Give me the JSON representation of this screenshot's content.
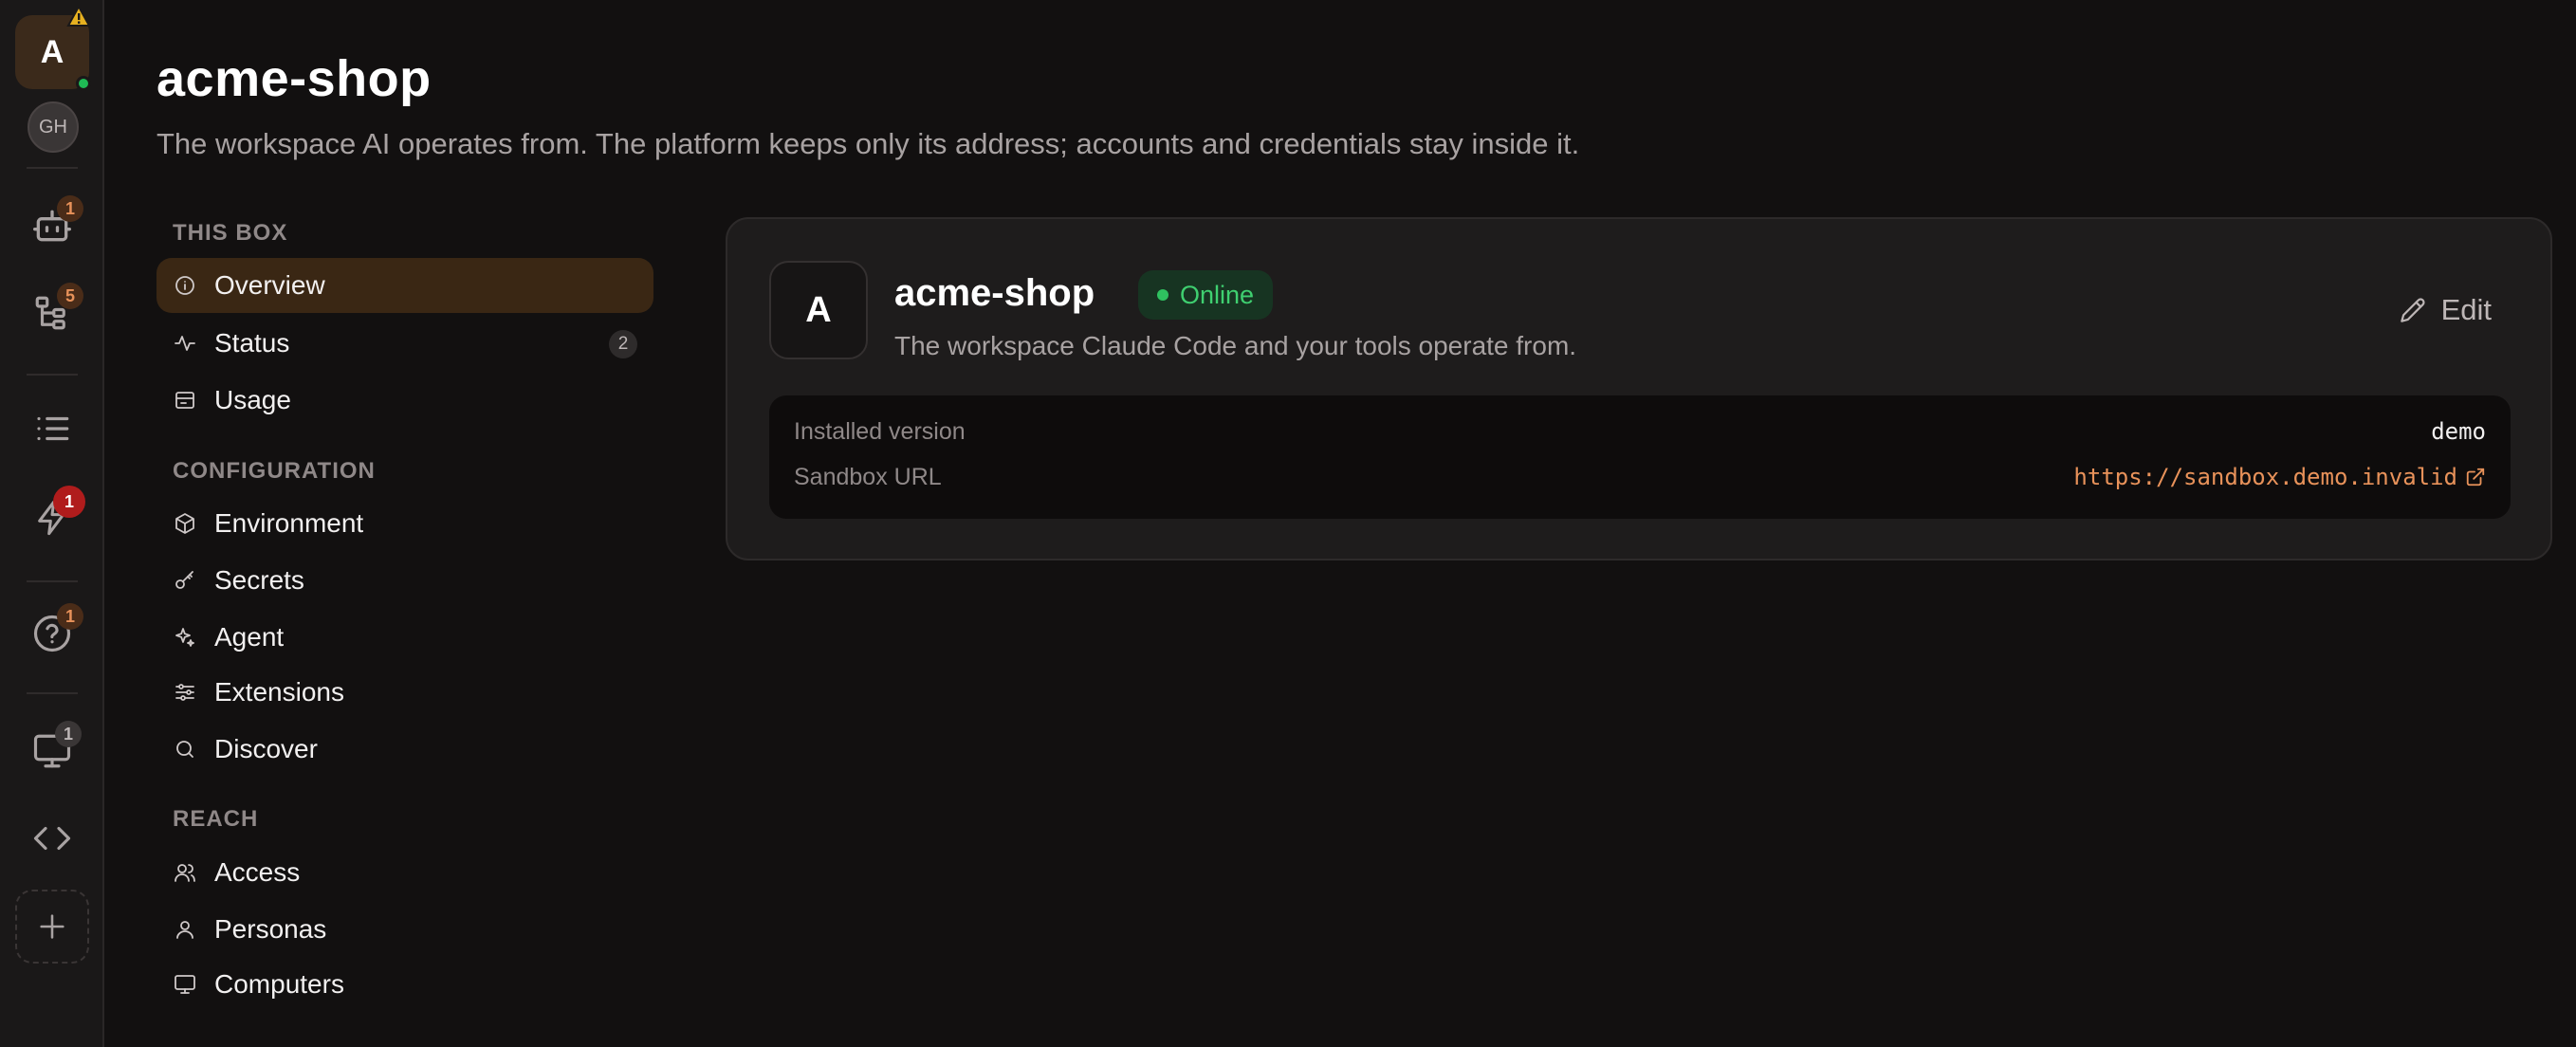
{
  "rail": {
    "workspace_initial": "A",
    "user_initials": "GH",
    "badges": {
      "agents": "1",
      "flows": "5",
      "triggers": "1",
      "help": "1",
      "computers": "1"
    },
    "icons": [
      "warning-icon",
      "bot-icon",
      "tree-icon",
      "list-icon",
      "lightning-icon",
      "help-icon",
      "monitor-icon",
      "code-icon",
      "plus-icon"
    ]
  },
  "header": {
    "title": "acme-shop",
    "subtitle": "The workspace AI operates from. The platform keeps only its address; accounts and credentials stay inside it."
  },
  "nav": {
    "sections": [
      {
        "title": "THIS BOX",
        "items": [
          {
            "label": "Overview",
            "icon": "info-icon",
            "active": true
          },
          {
            "label": "Status",
            "icon": "activity-icon",
            "count": "2"
          },
          {
            "label": "Usage",
            "icon": "usage-icon"
          }
        ]
      },
      {
        "title": "CONFIGURATION",
        "items": [
          {
            "label": "Environment",
            "icon": "cube-icon"
          },
          {
            "label": "Secrets",
            "icon": "key-icon"
          },
          {
            "label": "Agent",
            "icon": "sparkles-icon"
          },
          {
            "label": "Extensions",
            "icon": "sliders-icon"
          },
          {
            "label": "Discover",
            "icon": "search-icon"
          }
        ]
      },
      {
        "title": "REACH",
        "items": [
          {
            "label": "Access",
            "icon": "users-icon"
          },
          {
            "label": "Personas",
            "icon": "user-icon"
          },
          {
            "label": "Computers",
            "icon": "monitor-icon"
          }
        ]
      }
    ]
  },
  "card": {
    "avatar_initial": "A",
    "name": "acme-shop",
    "status": "Online",
    "description": "The workspace Claude Code and your tools operate from.",
    "edit_label": "Edit",
    "info": {
      "installed_version_label": "Installed version",
      "installed_version_value": "demo",
      "sandbox_url_label": "Sandbox URL",
      "sandbox_url_value": "https://sandbox.demo.invalid"
    }
  },
  "colors": {
    "accent": "#e8925a",
    "online": "#2fc160",
    "danger": "#b01c1c",
    "active_nav": "#3a2714"
  }
}
